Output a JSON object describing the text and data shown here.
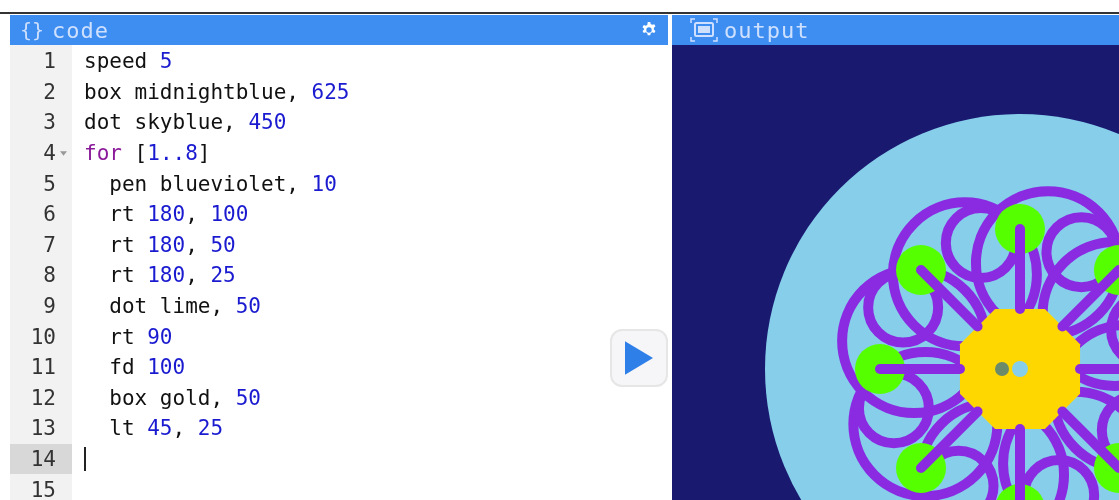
{
  "code_panel": {
    "icon": "{}",
    "title": "code",
    "lines": [
      {
        "number": "1",
        "selected": false,
        "tokens": [
          {
            "text": "speed ",
            "kind": "plain"
          },
          {
            "text": "5",
            "kind": "number"
          }
        ]
      },
      {
        "number": "2",
        "selected": false,
        "tokens": [
          {
            "text": "box midnightblue, ",
            "kind": "plain"
          },
          {
            "text": "625",
            "kind": "number"
          }
        ]
      },
      {
        "number": "3",
        "selected": false,
        "tokens": [
          {
            "text": "dot skyblue, ",
            "kind": "plain"
          },
          {
            "text": "450",
            "kind": "number"
          }
        ]
      },
      {
        "number": "4",
        "selected": false,
        "expanded": true,
        "tokens": [
          {
            "text": "for",
            "kind": "keyword"
          },
          {
            "text": " [",
            "kind": "plain"
          },
          {
            "text": "1..8",
            "kind": "number"
          },
          {
            "text": "]",
            "kind": "plain"
          }
        ],
        "children": [
          {
            "number": "5",
            "selected": false,
            "tokens": [
              {
                "text": "pen blueviolet, ",
                "kind": "plain"
              },
              {
                "text": "10",
                "kind": "number"
              }
            ]
          },
          {
            "number": "6",
            "selected": false,
            "tokens": [
              {
                "text": "rt ",
                "kind": "plain"
              },
              {
                "text": "180",
                "kind": "number"
              },
              {
                "text": ", ",
                "kind": "plain"
              },
              {
                "text": "100",
                "kind": "number"
              }
            ]
          },
          {
            "number": "7",
            "selected": false,
            "tokens": [
              {
                "text": "rt ",
                "kind": "plain"
              },
              {
                "text": "180",
                "kind": "number"
              },
              {
                "text": ", ",
                "kind": "plain"
              },
              {
                "text": "50",
                "kind": "number"
              }
            ]
          },
          {
            "number": "8",
            "selected": false,
            "tokens": [
              {
                "text": "rt ",
                "kind": "plain"
              },
              {
                "text": "180",
                "kind": "number"
              },
              {
                "text": ", ",
                "kind": "plain"
              },
              {
                "text": "25",
                "kind": "number"
              }
            ]
          },
          {
            "number": "9",
            "selected": false,
            "tokens": [
              {
                "text": "dot lime, ",
                "kind": "plain"
              },
              {
                "text": "50",
                "kind": "number"
              }
            ]
          },
          {
            "number": "10",
            "selected": false,
            "tokens": [
              {
                "text": "rt ",
                "kind": "plain"
              },
              {
                "text": "90",
                "kind": "number"
              }
            ]
          },
          {
            "number": "11",
            "selected": false,
            "tokens": [
              {
                "text": "fd ",
                "kind": "plain"
              },
              {
                "text": "100",
                "kind": "number"
              }
            ]
          },
          {
            "number": "12",
            "selected": false,
            "tokens": [
              {
                "text": "box gold, ",
                "kind": "plain"
              },
              {
                "text": "50",
                "kind": "number"
              }
            ]
          },
          {
            "number": "13",
            "selected": false,
            "tokens": [
              {
                "text": "lt ",
                "kind": "plain"
              },
              {
                "text": "45",
                "kind": "number"
              },
              {
                "text": ", ",
                "kind": "plain"
              },
              {
                "text": "25",
                "kind": "number"
              }
            ]
          }
        ]
      },
      {
        "number": "14",
        "selected": true
      },
      {
        "number": "15",
        "selected": false
      }
    ]
  },
  "output_panel": {
    "title": "output"
  }
}
